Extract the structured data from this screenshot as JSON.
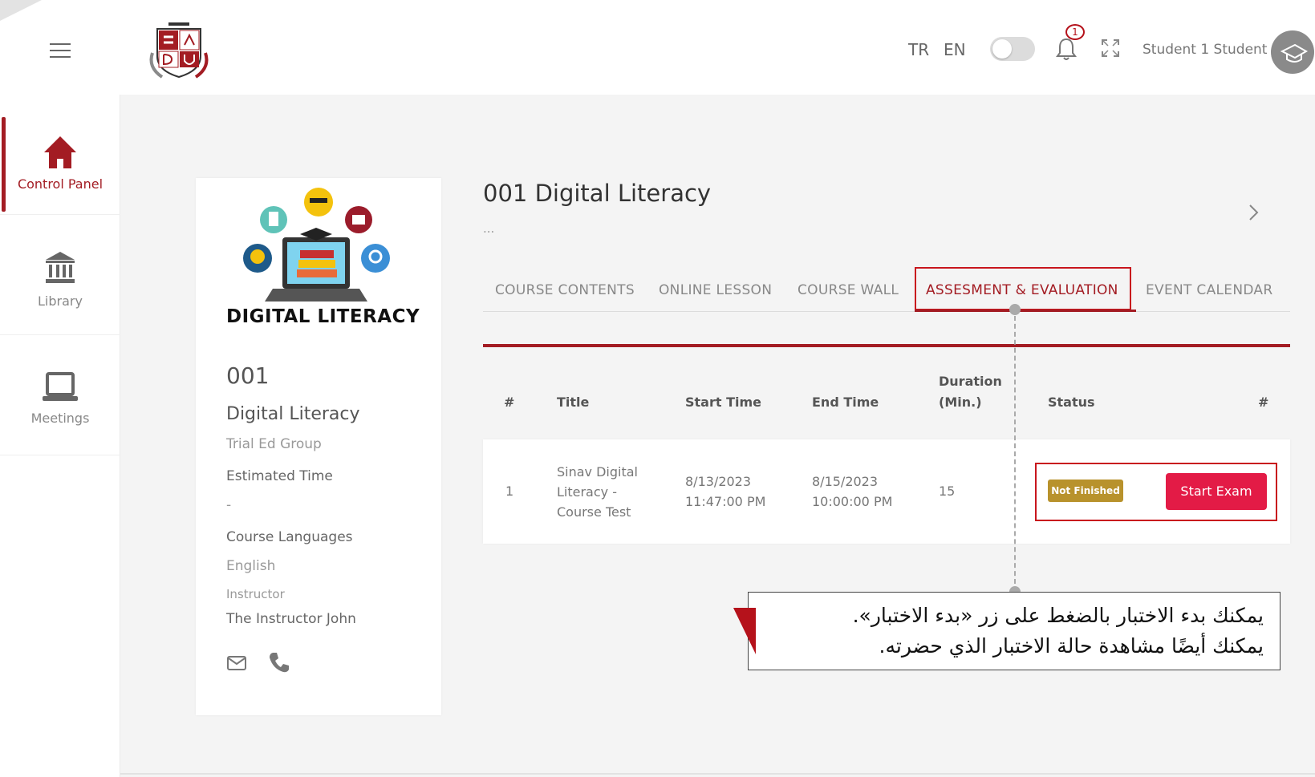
{
  "header": {
    "languages": [
      "TR",
      "EN"
    ],
    "notification_count": "1",
    "user_name": "Student 1 Student"
  },
  "sidebar": {
    "items": [
      {
        "label": "Control Panel",
        "icon": "home-icon"
      },
      {
        "label": "Library",
        "icon": "library-icon"
      },
      {
        "label": "Meetings",
        "icon": "laptop-icon"
      }
    ]
  },
  "card": {
    "brand": "DIGITAL LITERACY",
    "code": "001",
    "name": "Digital Literacy",
    "group": "Trial Ed Group",
    "estimated_time_label": "Estimated Time",
    "estimated_time_value": "-",
    "languages_label": "Course Languages",
    "languages_value": "English",
    "instructor_label": "Instructor",
    "instructor_value": "The Instructor John"
  },
  "main": {
    "title": "001 Digital Literacy",
    "subtitle": "...",
    "tabs": [
      "COURSE CONTENTS",
      "ONLINE LESSON",
      "COURSE WALL",
      "ASSESMENT & EVALUATION",
      "EVENT CALENDAR"
    ],
    "active_tab": "ASSESMENT & EVALUATION"
  },
  "table": {
    "headers": [
      "#",
      "Title",
      "Start Time",
      "End Time",
      "Duration",
      "(Min.)",
      "Status",
      "#"
    ],
    "rows": [
      {
        "index": "1",
        "title_lines": [
          "Sinav Digital",
          "Literacy -",
          "Course Test"
        ],
        "start_date": "8/13/2023",
        "start_time": "11:47:00 PM",
        "end_date": "8/15/2023",
        "end_time": "10:00:00 PM",
        "duration": "15",
        "status": "Not Finished",
        "action": "Start Exam"
      }
    ]
  },
  "callout": {
    "line1": "يمكنك بدء الاختبار بالضغط على زر «بدء الاختبار».",
    "line2": "يمكنك أيضًا مشاهدة حالة الاختبار الذي حضرته."
  },
  "colors": {
    "accent": "#a31c23",
    "button": "#e31b46",
    "badge": "#b8922c"
  }
}
